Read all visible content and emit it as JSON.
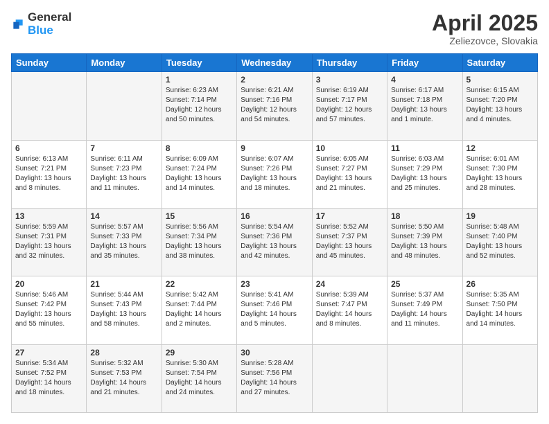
{
  "logo": {
    "general": "General",
    "blue": "Blue"
  },
  "header": {
    "title": "April 2025",
    "subtitle": "Zeliezovce, Slovakia"
  },
  "weekdays": [
    "Sunday",
    "Monday",
    "Tuesday",
    "Wednesday",
    "Thursday",
    "Friday",
    "Saturday"
  ],
  "weeks": [
    [
      {
        "day": "",
        "info": ""
      },
      {
        "day": "",
        "info": ""
      },
      {
        "day": "1",
        "info": "Sunrise: 6:23 AM\nSunset: 7:14 PM\nDaylight: 12 hours and 50 minutes."
      },
      {
        "day": "2",
        "info": "Sunrise: 6:21 AM\nSunset: 7:16 PM\nDaylight: 12 hours and 54 minutes."
      },
      {
        "day": "3",
        "info": "Sunrise: 6:19 AM\nSunset: 7:17 PM\nDaylight: 12 hours and 57 minutes."
      },
      {
        "day": "4",
        "info": "Sunrise: 6:17 AM\nSunset: 7:18 PM\nDaylight: 13 hours and 1 minute."
      },
      {
        "day": "5",
        "info": "Sunrise: 6:15 AM\nSunset: 7:20 PM\nDaylight: 13 hours and 4 minutes."
      }
    ],
    [
      {
        "day": "6",
        "info": "Sunrise: 6:13 AM\nSunset: 7:21 PM\nDaylight: 13 hours and 8 minutes."
      },
      {
        "day": "7",
        "info": "Sunrise: 6:11 AM\nSunset: 7:23 PM\nDaylight: 13 hours and 11 minutes."
      },
      {
        "day": "8",
        "info": "Sunrise: 6:09 AM\nSunset: 7:24 PM\nDaylight: 13 hours and 14 minutes."
      },
      {
        "day": "9",
        "info": "Sunrise: 6:07 AM\nSunset: 7:26 PM\nDaylight: 13 hours and 18 minutes."
      },
      {
        "day": "10",
        "info": "Sunrise: 6:05 AM\nSunset: 7:27 PM\nDaylight: 13 hours and 21 minutes."
      },
      {
        "day": "11",
        "info": "Sunrise: 6:03 AM\nSunset: 7:29 PM\nDaylight: 13 hours and 25 minutes."
      },
      {
        "day": "12",
        "info": "Sunrise: 6:01 AM\nSunset: 7:30 PM\nDaylight: 13 hours and 28 minutes."
      }
    ],
    [
      {
        "day": "13",
        "info": "Sunrise: 5:59 AM\nSunset: 7:31 PM\nDaylight: 13 hours and 32 minutes."
      },
      {
        "day": "14",
        "info": "Sunrise: 5:57 AM\nSunset: 7:33 PM\nDaylight: 13 hours and 35 minutes."
      },
      {
        "day": "15",
        "info": "Sunrise: 5:56 AM\nSunset: 7:34 PM\nDaylight: 13 hours and 38 minutes."
      },
      {
        "day": "16",
        "info": "Sunrise: 5:54 AM\nSunset: 7:36 PM\nDaylight: 13 hours and 42 minutes."
      },
      {
        "day": "17",
        "info": "Sunrise: 5:52 AM\nSunset: 7:37 PM\nDaylight: 13 hours and 45 minutes."
      },
      {
        "day": "18",
        "info": "Sunrise: 5:50 AM\nSunset: 7:39 PM\nDaylight: 13 hours and 48 minutes."
      },
      {
        "day": "19",
        "info": "Sunrise: 5:48 AM\nSunset: 7:40 PM\nDaylight: 13 hours and 52 minutes."
      }
    ],
    [
      {
        "day": "20",
        "info": "Sunrise: 5:46 AM\nSunset: 7:42 PM\nDaylight: 13 hours and 55 minutes."
      },
      {
        "day": "21",
        "info": "Sunrise: 5:44 AM\nSunset: 7:43 PM\nDaylight: 13 hours and 58 minutes."
      },
      {
        "day": "22",
        "info": "Sunrise: 5:42 AM\nSunset: 7:44 PM\nDaylight: 14 hours and 2 minutes."
      },
      {
        "day": "23",
        "info": "Sunrise: 5:41 AM\nSunset: 7:46 PM\nDaylight: 14 hours and 5 minutes."
      },
      {
        "day": "24",
        "info": "Sunrise: 5:39 AM\nSunset: 7:47 PM\nDaylight: 14 hours and 8 minutes."
      },
      {
        "day": "25",
        "info": "Sunrise: 5:37 AM\nSunset: 7:49 PM\nDaylight: 14 hours and 11 minutes."
      },
      {
        "day": "26",
        "info": "Sunrise: 5:35 AM\nSunset: 7:50 PM\nDaylight: 14 hours and 14 minutes."
      }
    ],
    [
      {
        "day": "27",
        "info": "Sunrise: 5:34 AM\nSunset: 7:52 PM\nDaylight: 14 hours and 18 minutes."
      },
      {
        "day": "28",
        "info": "Sunrise: 5:32 AM\nSunset: 7:53 PM\nDaylight: 14 hours and 21 minutes."
      },
      {
        "day": "29",
        "info": "Sunrise: 5:30 AM\nSunset: 7:54 PM\nDaylight: 14 hours and 24 minutes."
      },
      {
        "day": "30",
        "info": "Sunrise: 5:28 AM\nSunset: 7:56 PM\nDaylight: 14 hours and 27 minutes."
      },
      {
        "day": "",
        "info": ""
      },
      {
        "day": "",
        "info": ""
      },
      {
        "day": "",
        "info": ""
      }
    ]
  ]
}
